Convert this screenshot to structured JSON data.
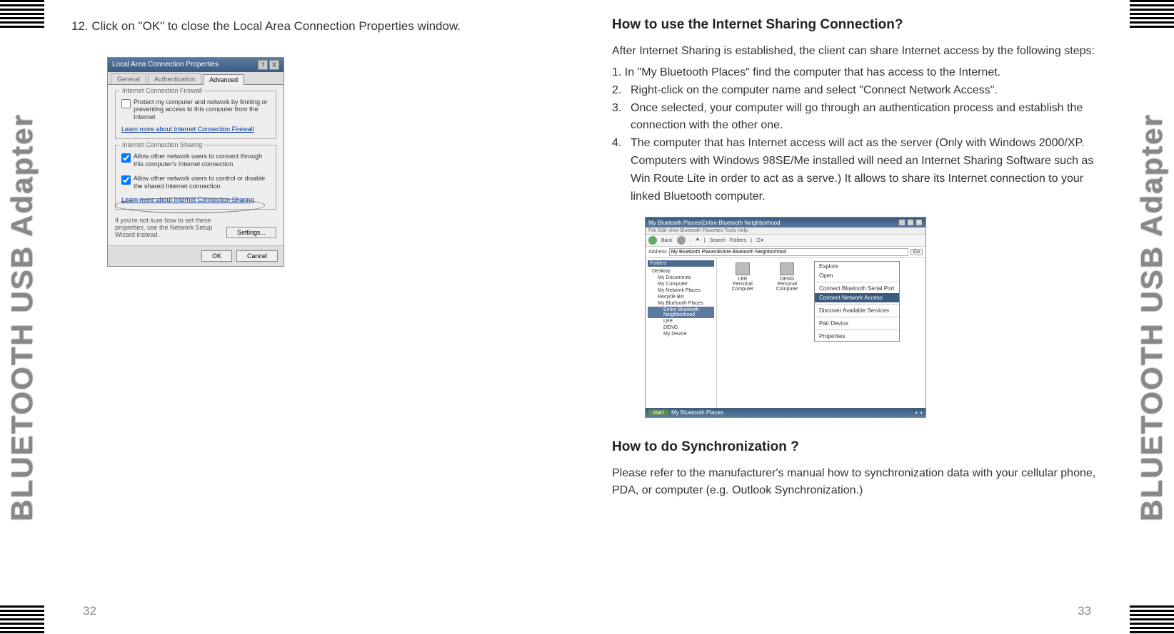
{
  "side_label": "BLUETOOTH USB Adapter",
  "left": {
    "step12": "12.  Click on \"OK\" to close the Local Area Connection Properties window.",
    "dialog": {
      "title": "Local Area Connection Properties",
      "tabs": {
        "general": "General",
        "auth": "Authentication",
        "advanced": "Advanced"
      },
      "group1_title": "Internet Connection Firewall",
      "chk1": "Protect my computer and network by limiting or preventing access to this computer from the Internet",
      "link1": "Learn more about Internet Connection Firewall",
      "group2_title": "Internet Connection Sharing",
      "chk2": "Allow other network users to connect through this computer's Internet connection",
      "chk3": "Allow other network users to control or disable the shared Internet connection",
      "link2": "Learn more about Internet Connection Sharing",
      "help": "If you're not sure how to set these properties, use the Network Setup Wizard instead.",
      "settings_btn": "Settings...",
      "ok": "OK",
      "cancel": "Cancel"
    }
  },
  "right": {
    "h1": "How to use the Internet Sharing Connection?",
    "intro1": "After Internet Sharing is established, the client can share Internet access by the following steps:",
    "li1": " 1.  In \"My Bluetooth Places\" find the computer that has access to the Internet.",
    "li2n": "2.",
    "li2": "Right-click on the computer name and select \"Connect Network Access\".",
    "li3n": "3.",
    "li3": "Once selected, your computer will go through an authentication process and establish the connection with the other one.",
    "li4n": "4.",
    "li4": "The computer that has Internet access will act as the server (Only with Windows 2000/XP.  Computers with Windows 98SE/Me installed will need an Internet Sharing Software such as Win Route Lite in order to act as a serve.)  It allows to share its Internet connection to your linked Bluetooth computer.",
    "explorer": {
      "title": "My Bluetooth Places\\Entire Bluetooth Neighborhood",
      "menu": "File   Edit   View   Bluetooth   Favorites   Tools   Help",
      "tool_back": "Back",
      "tool_search": "Search",
      "tool_folders": "Folders",
      "addr_label": "Address",
      "addr_val": "My Bluetooth Places\\Entire Bluetooth Neighborhood",
      "addr_go": "Go",
      "side_hdr": "Folders",
      "side": {
        "desktop": "Desktop",
        "mydocs": "My Documents",
        "mycomp": "My Computer",
        "mynet": "My Network Places",
        "recycle": "Recycle Bin",
        "mybtp": "My Bluetooth Places",
        "entire": "Entire Bluetooth Neighborhood",
        "lee": "LEE",
        "deng": "DENG",
        "mydev": "My Device"
      },
      "item1": "LEE\nPersonal Computer",
      "item2": "DENG\nPersonal Computer",
      "ctx": {
        "explore": "Explore",
        "open": "Open",
        "serial": "Connect Bluetooth Serial Port",
        "network": "Connect Network Access",
        "discover": "Discover Available Services",
        "pair": "Pair Device",
        "properties": "Properties"
      },
      "taskbar_start": "start",
      "taskbar_item": "My Bluetooth Places"
    },
    "h2": "How to do Synchronization ?",
    "sync_p": "Please refer to the manufacturer's manual how to synchronization data with your cellular phone, PDA, or computer (e.g. Outlook Synchronization.)"
  },
  "page_left": "32",
  "page_right": "33"
}
